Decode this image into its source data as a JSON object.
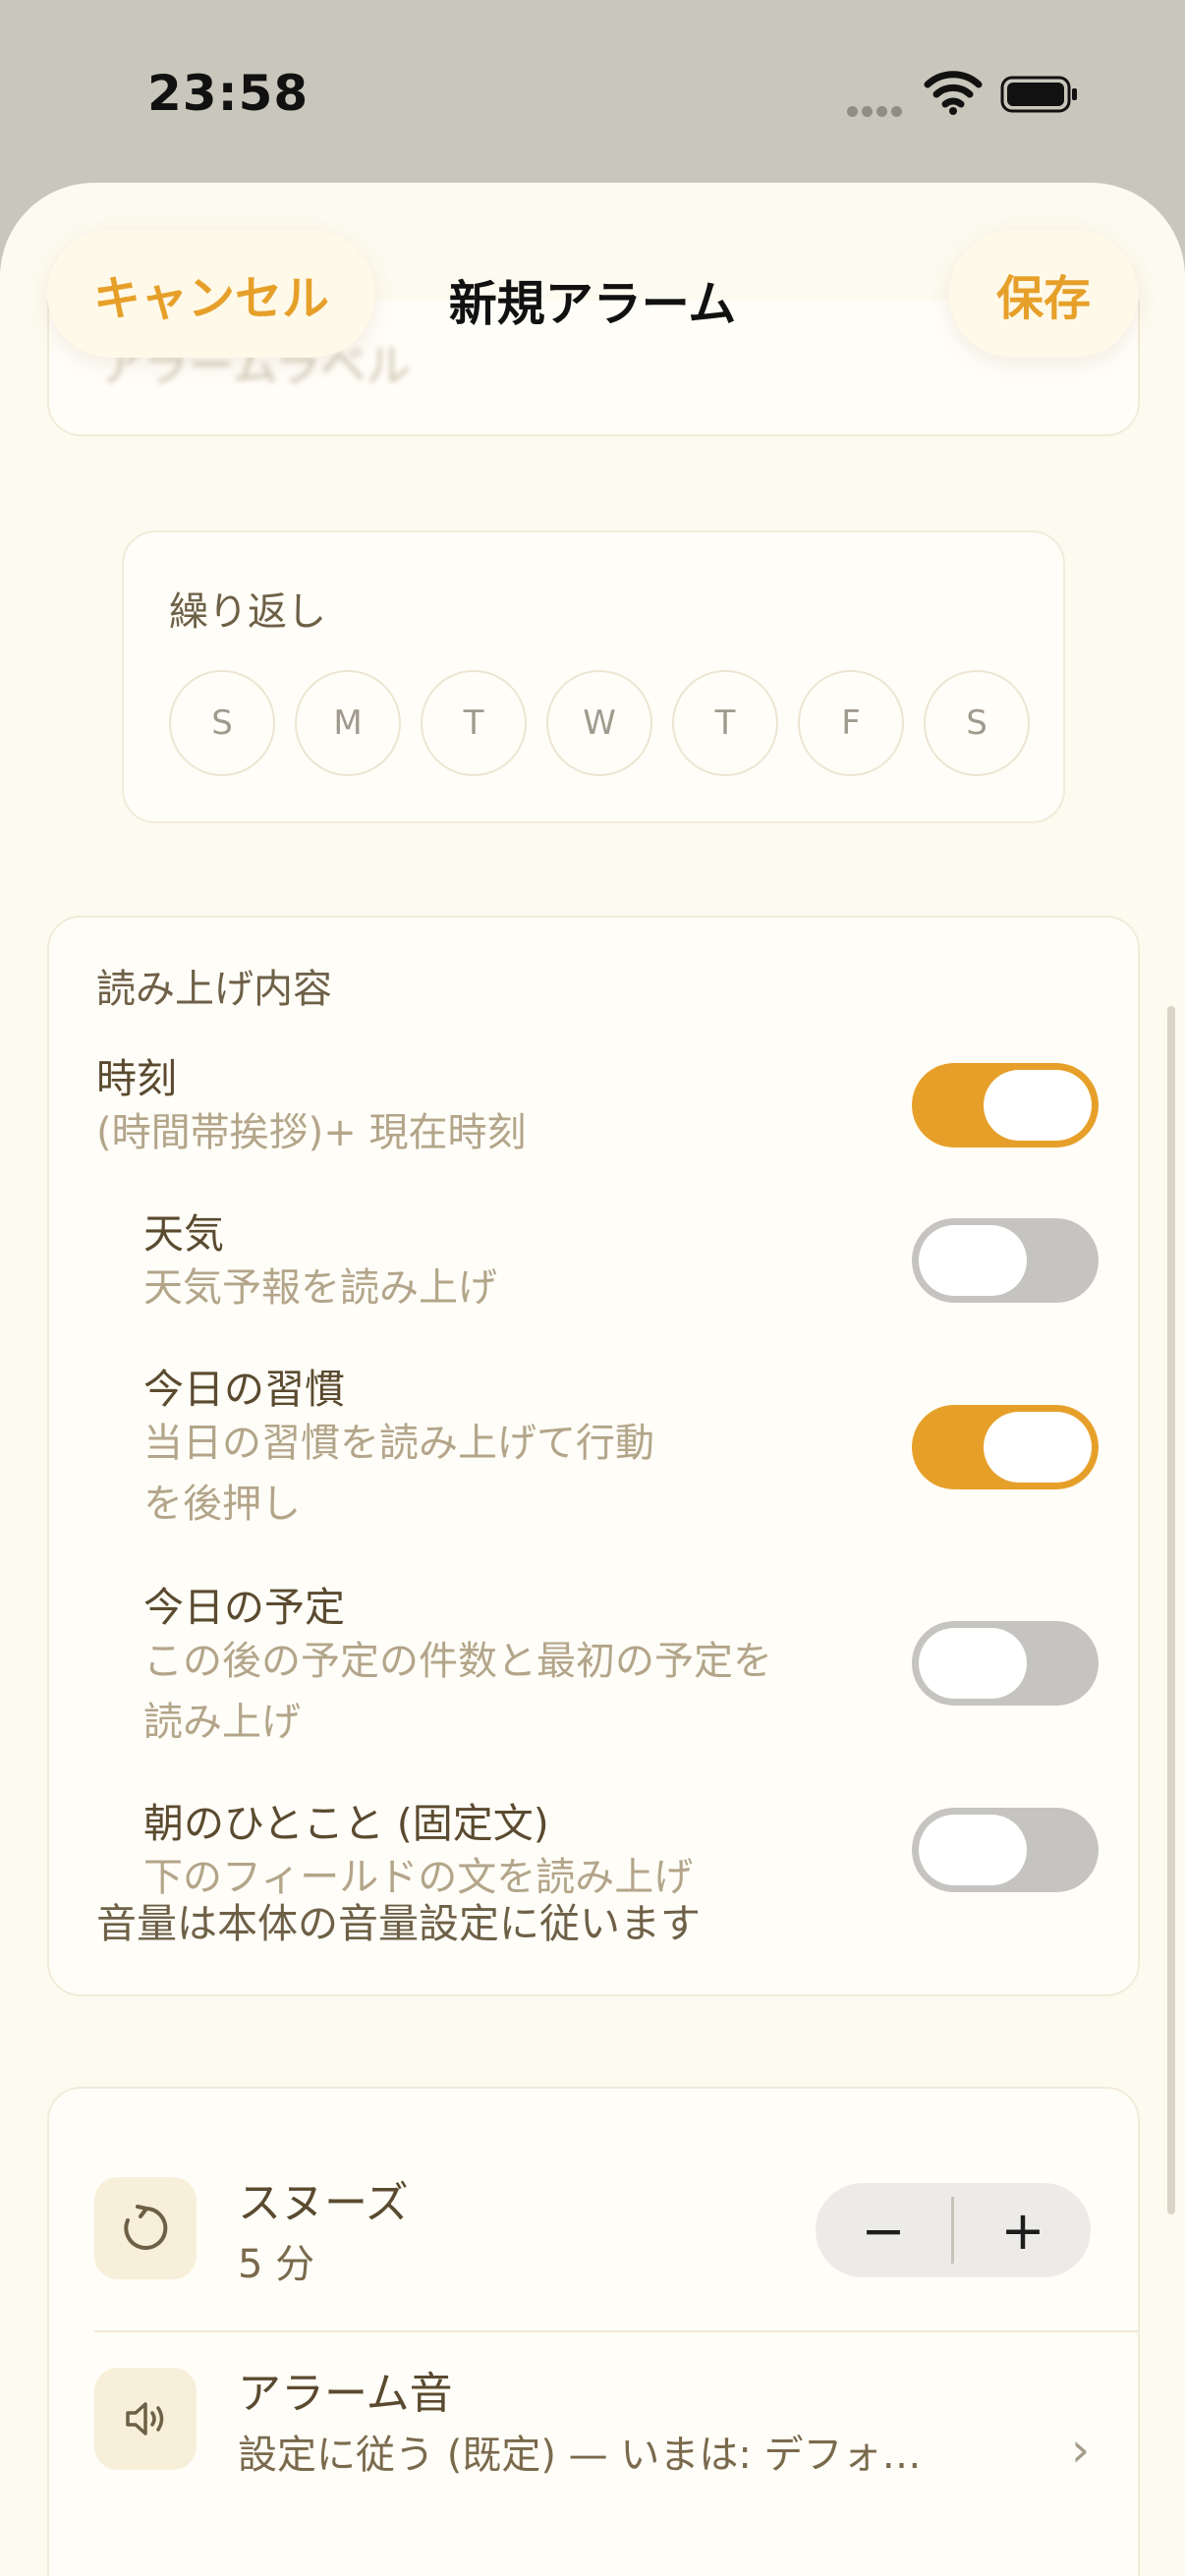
{
  "status_bar": {
    "time": "23:58"
  },
  "nav": {
    "cancel_label": "キャンセル",
    "title": "新規アラーム",
    "save_label": "保存"
  },
  "alarm_label": {
    "placeholder": "アラームラベル"
  },
  "repeat": {
    "title": "繰り返し",
    "days": [
      "S",
      "M",
      "T",
      "W",
      "T",
      "F",
      "S"
    ]
  },
  "readout": {
    "title": "読み上げ内容",
    "items": [
      {
        "title": "時刻",
        "subtitle": "(時間帯挨拶)+ 現在時刻",
        "enabled": true
      },
      {
        "title": "天気",
        "subtitle": "天気予報を読み上げ",
        "enabled": false
      },
      {
        "title": "今日の習慣",
        "subtitle_line1": "当日の習慣を読み上げて行動",
        "subtitle_line2": "を後押し",
        "enabled": true
      },
      {
        "title": "今日の予定",
        "subtitle_line1": "この後の予定の件数と最初の予定を",
        "subtitle_line2": "読み上げ",
        "enabled": false
      },
      {
        "title": "朝のひとこと (固定文)",
        "subtitle": "下のフィールドの文を読み上げ",
        "enabled": false
      }
    ],
    "footnote": "音量は本体の音量設定に従います"
  },
  "snooze": {
    "title": "スヌーズ",
    "value": "5 分",
    "minus": "−",
    "plus": "+"
  },
  "alarm_sound": {
    "title": "アラーム音",
    "value": "設定に従う (既定) — いまは: デフォ…"
  },
  "colors": {
    "accent": "#E6A02A",
    "background": "#FDFAEF",
    "toggle_off": "#C5C4C1"
  }
}
